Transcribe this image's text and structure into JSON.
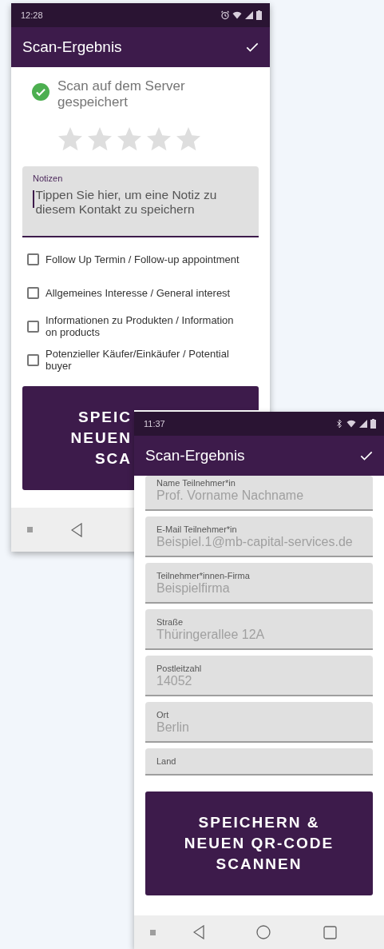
{
  "back_screen": {
    "status_time": "12:28",
    "title": "Scan-Ergebnis",
    "save_status": "Scan auf dem Server gespeichert",
    "rating": {
      "stars": 0
    },
    "notes": {
      "label": "Notizen",
      "placeholder": "Tippen Sie hier, um eine Notiz zu diesem Kontakt zu speichern",
      "focused": true
    },
    "checkboxes": [
      {
        "label": "Follow Up Termin / Follow-up appointment",
        "checked": false
      },
      {
        "label": "Allgemeines Interesse / General interest",
        "checked": false
      },
      {
        "label": "Informationen zu Produkten / Information on products",
        "checked": false
      },
      {
        "label": "Potenzieller Käufer/Einkäufer / Potential buyer",
        "checked": false
      }
    ],
    "button_lines": [
      "SPEIC",
      "NEUEN",
      "SCA"
    ]
  },
  "front_screen": {
    "status_time": "11:37",
    "title": "Scan-Ergebnis",
    "fields": [
      {
        "label": "Name Teilnehmer*in",
        "value": "Prof. Vorname Nachname"
      },
      {
        "label": "E-Mail Teilnehmer*in",
        "value": "Beispiel.1@mb-capital-services.de"
      },
      {
        "label": "Teilnehmer*innen-Firma",
        "value": "Beispielfirma"
      },
      {
        "label": "Straße",
        "value": "Thüringerallee 12A"
      },
      {
        "label": "Postleitzahl",
        "value": "14052"
      },
      {
        "label": "Ort",
        "value": "Berlin"
      },
      {
        "label": "Land"
      }
    ],
    "button": "SPEICHERN & NEUEN QR-CODE SCANNEN"
  }
}
